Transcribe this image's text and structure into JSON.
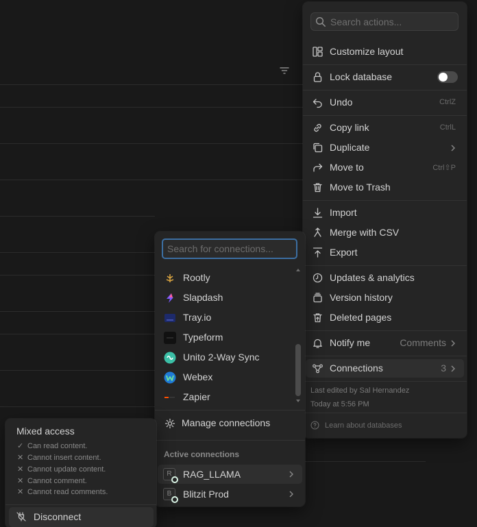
{
  "actions_menu": {
    "search_placeholder": "Search actions...",
    "items": [
      {
        "label": "Customize layout",
        "icon": "layout-icon"
      },
      {
        "label": "Lock database",
        "icon": "lock-icon",
        "toggle": false
      },
      {
        "label": "Undo",
        "icon": "undo-icon",
        "shortcut": "CtrlZ"
      },
      {
        "label": "Copy link",
        "icon": "link-icon",
        "shortcut": "CtrlL"
      },
      {
        "label": "Duplicate",
        "icon": "duplicate-icon"
      },
      {
        "label": "Move to",
        "icon": "move-to-icon",
        "shortcut": "Ctrl⇧P"
      },
      {
        "label": "Move to Trash",
        "icon": "trash-icon"
      },
      {
        "label": "Import",
        "icon": "import-icon"
      },
      {
        "label": "Merge with CSV",
        "icon": "merge-icon"
      },
      {
        "label": "Export",
        "icon": "export-icon"
      },
      {
        "label": "Updates & analytics",
        "icon": "clock-icon"
      },
      {
        "label": "Version history",
        "icon": "history-icon"
      },
      {
        "label": "Deleted pages",
        "icon": "deleted-icon"
      },
      {
        "label": "Notify me",
        "icon": "bell-icon",
        "value": "Comments"
      },
      {
        "label": "Connections",
        "icon": "connections-icon",
        "value": "3"
      }
    ],
    "last_edited": "Last edited by Sal Hernandez",
    "last_edited_time": "Today at 5:56 PM",
    "learn": "Learn about databases"
  },
  "connections_menu": {
    "search_placeholder": "Search for connections...",
    "items": [
      {
        "label": "Rootly",
        "color": "#d9a441"
      },
      {
        "label": "Slapdash",
        "color": "#7b5cff"
      },
      {
        "label": "Tray.io",
        "color": "#1d2a6b"
      },
      {
        "label": "Typeform",
        "color": "#111111"
      },
      {
        "label": "Unito 2-Way Sync",
        "color": "#3bbfa6"
      },
      {
        "label": "Webex",
        "color": "#1f7ad6"
      },
      {
        "label": "Zapier",
        "color": "#ff4f00"
      }
    ],
    "manage": "Manage connections",
    "active_heading": "Active connections",
    "active": [
      {
        "label": "RAG_LLAMA",
        "badge": "R"
      },
      {
        "label": "Blitzit Prod",
        "badge": "B"
      }
    ]
  },
  "access_panel": {
    "title": "Mixed access",
    "permissions": [
      {
        "mark": "✓",
        "text": "Can read content."
      },
      {
        "mark": "✕",
        "text": "Cannot insert content."
      },
      {
        "mark": "✕",
        "text": "Cannot update content."
      },
      {
        "mark": "✕",
        "text": "Cannot comment."
      },
      {
        "mark": "✕",
        "text": "Cannot read comments."
      }
    ],
    "disconnect": "Disconnect"
  }
}
